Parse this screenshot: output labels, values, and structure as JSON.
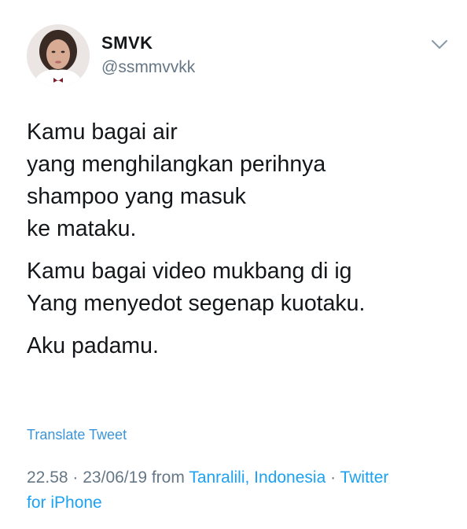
{
  "user": {
    "display_name": "SMVK",
    "handle": "@ssmmvvkk",
    "avatar_icon": "profile-photo"
  },
  "menu_icon": "chevron-down-icon",
  "tweet": {
    "paragraphs": [
      {
        "lines": [
          "Kamu bagai air",
          "yang menghilangkan perihnya",
          "shampoo yang masuk",
          "ke mataku."
        ]
      },
      {
        "lines": [
          "Kamu bagai video mukbang di ig",
          "Yang menyedot segenap kuotaku."
        ]
      },
      {
        "lines": [
          "Aku padamu."
        ]
      }
    ]
  },
  "translate_label": "Translate Tweet",
  "meta": {
    "time": "22.58",
    "separator": "·",
    "date": "23/06/19",
    "from_label": "from",
    "location": "Tanralili, Indonesia",
    "source_line1": "Twitter",
    "source_line2": "for iPhone"
  },
  "colors": {
    "text": "#14171a",
    "secondary": "#657786",
    "link": "#1da1f2"
  }
}
